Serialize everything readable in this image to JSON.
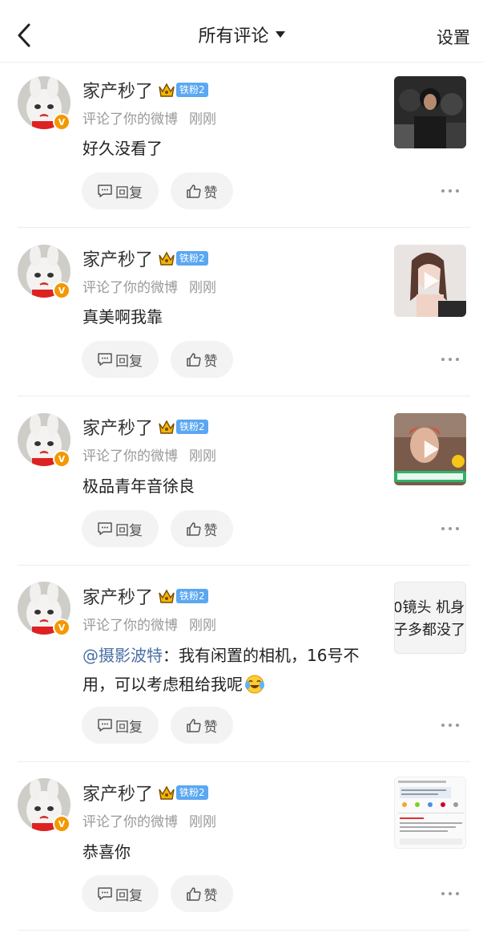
{
  "header": {
    "title": "所有评论",
    "settings_label": "设置"
  },
  "comments": [
    {
      "user": "家产秒了",
      "fan_badge": "铁粉2",
      "action": "评论了你的微博",
      "time": "刚刚",
      "mention": "",
      "text": "好久没看了",
      "reply_label": "回复",
      "like_label": "赞",
      "thumb_text": ""
    },
    {
      "user": "家产秒了",
      "fan_badge": "铁粉2",
      "action": "评论了你的微博",
      "time": "刚刚",
      "mention": "",
      "text": "真美啊我靠",
      "reply_label": "回复",
      "like_label": "赞",
      "thumb_text": ""
    },
    {
      "user": "家产秒了",
      "fan_badge": "铁粉2",
      "action": "评论了你的微博",
      "time": "刚刚",
      "mention": "",
      "text": "极品青年音徐良",
      "reply_label": "回复",
      "like_label": "赞",
      "thumb_text": ""
    },
    {
      "user": "家产秒了",
      "fan_badge": "铁粉2",
      "action": "评论了你的微博",
      "time": "刚刚",
      "mention": "@摄影波特",
      "text": "：我有闲置的相机，16号不用，可以考虑租给我呢",
      "reply_label": "回复",
      "like_label": "赞",
      "thumb_text": "0镜头 机身 子多都没了"
    },
    {
      "user": "家产秒了",
      "fan_badge": "铁粉2",
      "action": "评论了你的微博",
      "time": "刚刚",
      "mention": "",
      "text": "恭喜你",
      "reply_label": "回复",
      "like_label": "赞",
      "thumb_text": ""
    }
  ]
}
